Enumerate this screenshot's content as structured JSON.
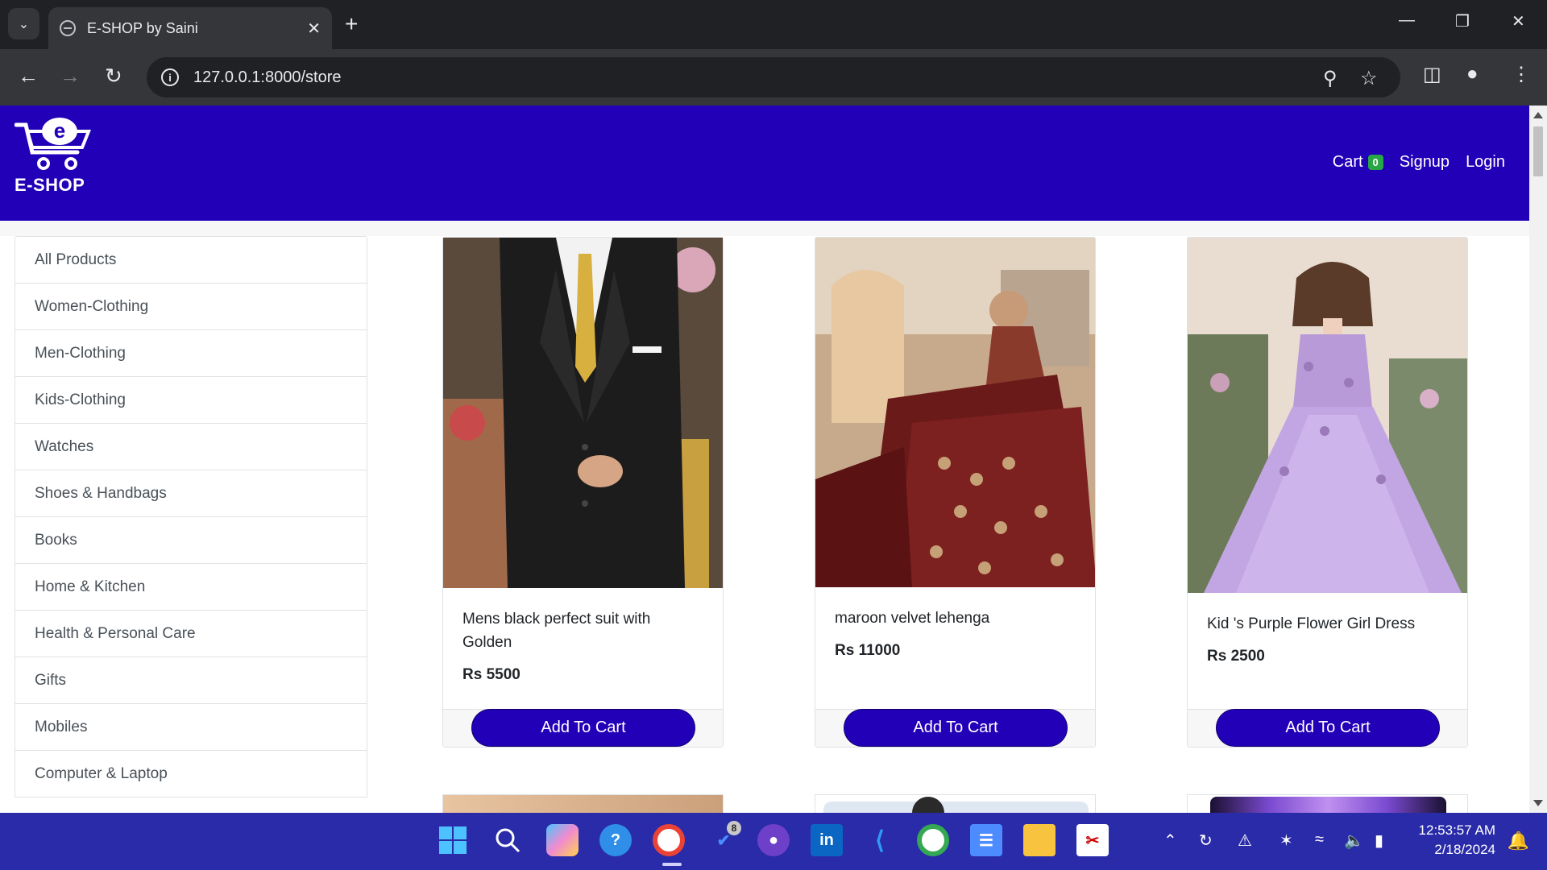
{
  "browser": {
    "tab_title": "E-SHOP by Saini",
    "url": "127.0.0.1:8000/store"
  },
  "site": {
    "brand": "E-SHOP",
    "nav": {
      "cart_label": "Cart",
      "cart_count": "0",
      "signup": "Signup",
      "login": "Login"
    }
  },
  "categories": [
    "All Products",
    "Women-Clothing",
    "Men-Clothing",
    "Kids-Clothing",
    "Watches",
    "Shoes & Handbags",
    "Books",
    "Home & Kitchen",
    "Health & Personal Care",
    "Gifts",
    "Mobiles",
    "Computer & Laptop"
  ],
  "products": [
    {
      "name": "Mens black perfect suit with Golden",
      "price": "Rs 5500",
      "button": "Add To Cart"
    },
    {
      "name": "maroon velvet lehenga",
      "price": "Rs 11000",
      "button": "Add To Cart"
    },
    {
      "name": "Kid 's Purple Flower Girl Dress",
      "price": "Rs 2500",
      "button": "Add To Cart"
    }
  ],
  "taskbar": {
    "time": "12:53:57 AM",
    "date": "2/18/2024",
    "todo_badge": "8"
  }
}
